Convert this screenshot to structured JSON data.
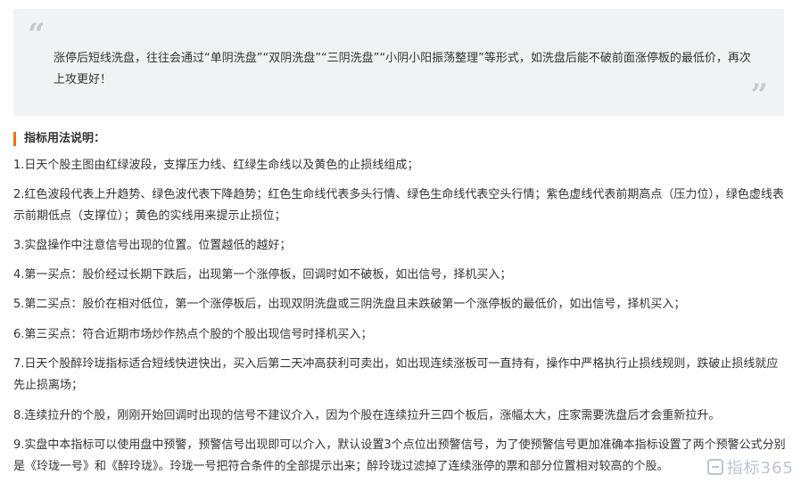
{
  "quote": {
    "open_mark": "“",
    "close_mark": "”",
    "text": "涨停后短线洗盘，往往会通过“单阴洗盘”“双阴洗盘”“三阴洗盘”“小阴小阳振荡整理”等形式，如洗盘后能不破前面涨停板的最低价，再次上攻更好！"
  },
  "section": {
    "heading": "指标用法说明："
  },
  "paragraphs": [
    "1.日天个股主图由红绿波段，支撑压力线、红绿生命线以及黄色的止损线组成；",
    "2.红色波段代表上升趋势、绿色波代表下降趋势；红色生命线代表多头行情、绿色生命线代表空头行情；紫色虚线代表前期高点（压力位），绿色虚线表示前期低点（支撑位）；黄色的实线用来提示止损位；",
    "3.实盘操作中注意信号出现的位置。位置越低的越好；",
    "4.第一买点：股价经过长期下跌后，出现第一个涨停板，回调时如不破板，如出信号，择机买入；",
    "5.第二买点：股价在相对低位，第一个涨停板后，出现双阴洗盘或三阴洗盘且未跌破第一个涨停板的最低价，如出信号，择机买入；",
    "6.第三买点：符合近期市场炒作热点个股的个股出现信号时择机买入；",
    "7.日天个股醉玲珑指标适合短线快进快出，买入后第二天冲高获利可卖出，如出现连续涨板可一直持有，操作中严格执行止损线规则，跌破止损线就应先止损离场；",
    "8.连续拉升的个股，刚刚开始回调时出现的信号不建议介入，因为个股在连续拉升三四个板后，涨幅太大，庄家需要洗盘后才会重新拉升。",
    "9.实盘中本指标可以使用盘中预警，预警信号出现即可以介入，默认设置3个点位出预警信号，为了使预警信号更加准确本指标设置了两个预警公式分别是《玲珑一号》和《醉玲珑》。玲珑一号把符合条件的全部提示出来；醉玲珑过滤掉了连续涨停的票和部分位置相对较高的个股。"
  ],
  "watermark": {
    "text": "指标365",
    "icon": "logo-icon"
  }
}
